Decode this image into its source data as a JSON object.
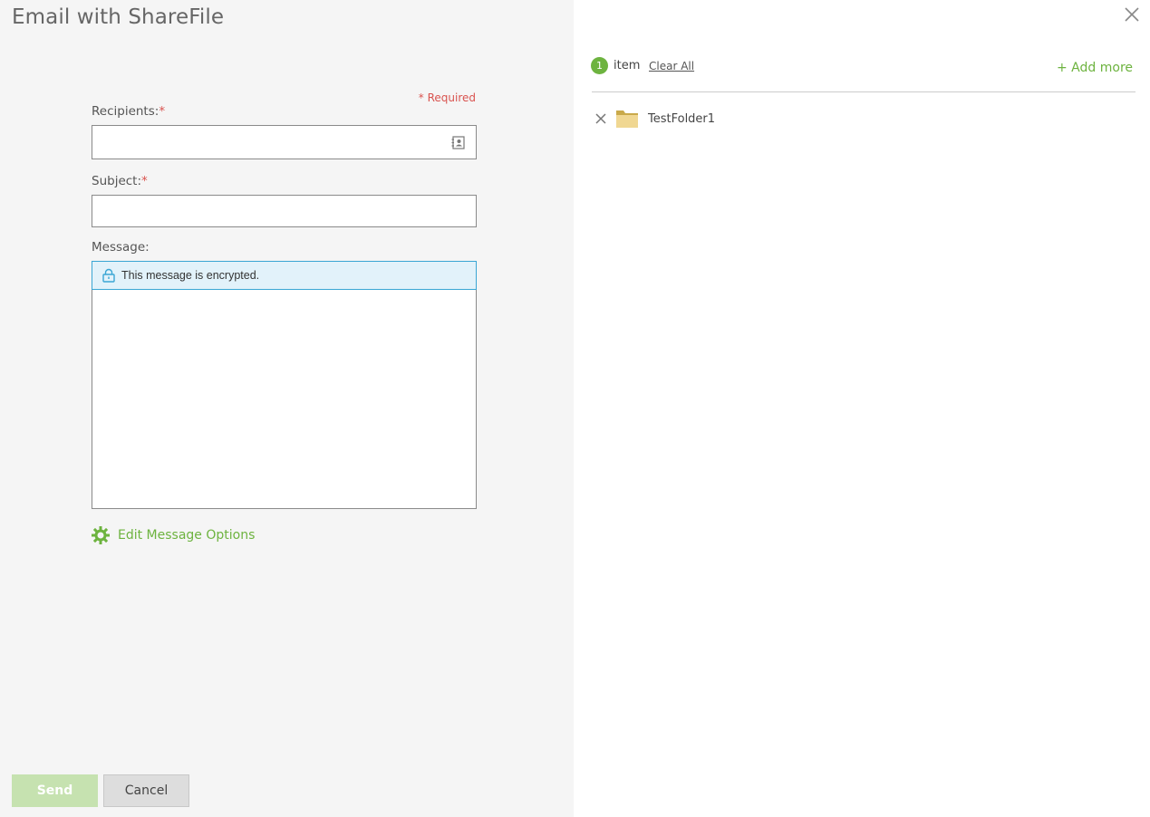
{
  "dialog": {
    "title": "Email with ShareFile",
    "close_icon": "close-icon"
  },
  "form": {
    "required_note": "* Required",
    "recipients": {
      "label": "Recipients:",
      "required_mark": "*",
      "value": "",
      "placeholder": "",
      "icon": "address-book-icon"
    },
    "subject": {
      "label": "Subject:",
      "required_mark": "*",
      "value": "",
      "placeholder": ""
    },
    "message": {
      "label": "Message:",
      "encryption_notice": "This message is encrypted.",
      "encryption_icon": "lock-icon",
      "value": ""
    },
    "edit_options_label": "Edit Message Options",
    "edit_options_icon": "gear-icon"
  },
  "actions": {
    "send_label": "Send",
    "cancel_label": "Cancel"
  },
  "items_panel": {
    "count": "1",
    "count_label": "item",
    "clear_all_label": "Clear All",
    "add_more_label": "+ Add more",
    "items": [
      {
        "name": "TestFolder1",
        "type_icon": "folder-icon",
        "remove_icon": "remove-icon"
      }
    ]
  },
  "colors": {
    "accent_green": "#6db33f",
    "send_disabled": "#c6e2b0",
    "required_red": "#d9534f",
    "encrypt_banner_bg": "#e2f2fa",
    "encrypt_banner_border": "#3aa6d4",
    "left_panel_bg": "#f5f5f5"
  }
}
